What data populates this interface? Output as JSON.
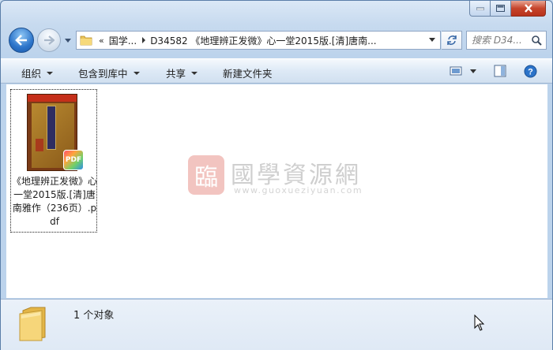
{
  "nav": {
    "breadcrumb_root": "国学...",
    "breadcrumb_current": "D34582 《地理辨正发微》心一堂2015版.[清]唐南...",
    "search_placeholder": "搜索 D34..."
  },
  "toolbar": {
    "organize": "组织",
    "include_in_library": "包含到库中",
    "share": "共享",
    "new_folder": "新建文件夹"
  },
  "file": {
    "name": "《地理辨正发微》心一堂2015版.[清]唐南雅作（236页）.pdf",
    "badge": "PDF",
    "thumb_banner": "PDF"
  },
  "watermark": {
    "seal": "臨",
    "title": "國學資源網",
    "url": "www.guoxueziyuan.com"
  },
  "details": {
    "count_text": "1 个对象"
  },
  "colors": {
    "accent_blue": "#2b73c9",
    "close_red": "#c6452c",
    "window_frame": "#bcd3ec"
  }
}
